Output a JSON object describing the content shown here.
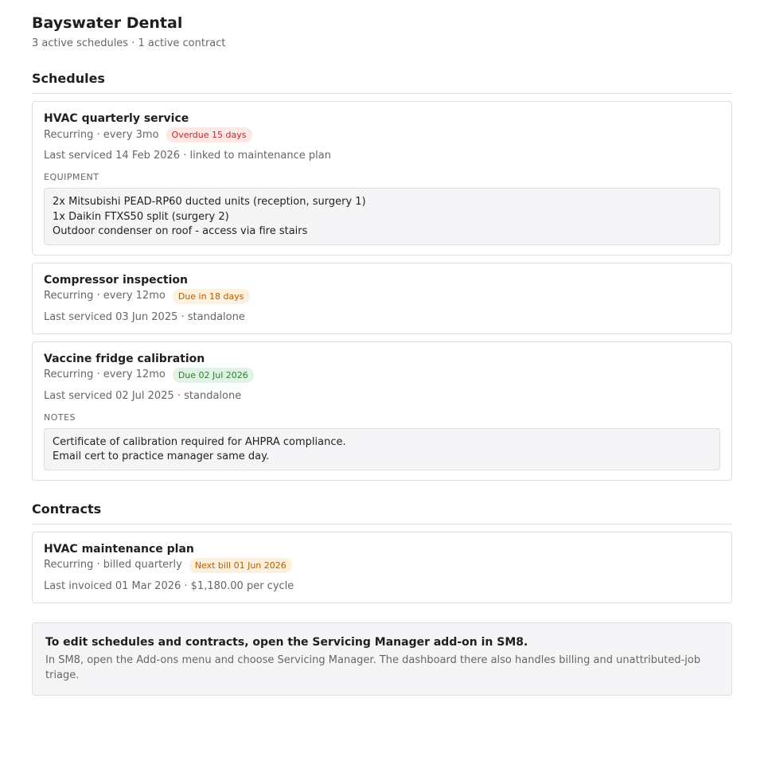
{
  "header": {
    "title": "Bayswater Dental",
    "subtitle": "3 active schedules · 1 active contract"
  },
  "schedules": {
    "heading": "Schedules",
    "items": [
      {
        "title": "HVAC quarterly service",
        "recurrence": "Recurring · every 3mo",
        "badge": "Overdue 15 days",
        "badge_color": "#c62828",
        "detail": "Last serviced 14 Feb 2026 · linked to maintenance plan",
        "extra_label": "EQUIPMENT",
        "extra_lines": [
          "2x Mitsubishi PEAD-RP60 ducted units (reception, surgery 1)",
          "1x Daikin FTXS50 split (surgery 2)",
          "Outdoor condenser on roof - access via fire stairs"
        ]
      },
      {
        "title": "Compressor inspection",
        "recurrence": "Recurring · every 12mo",
        "badge": "Due in 18 days",
        "badge_color": "#b35f00",
        "detail": "Last serviced 03 Jun 2025 · standalone"
      },
      {
        "title": "Vaccine fridge calibration",
        "recurrence": "Recurring · every 12mo",
        "badge": "Due 02 Jul 2026",
        "badge_color": "#2e7d32",
        "detail": "Last serviced 02 Jul 2025 · standalone",
        "extra_label": "NOTES",
        "extra_lines": [
          "Certificate of calibration required for AHPRA compliance.",
          "Email cert to practice manager same day."
        ]
      }
    ]
  },
  "contracts": {
    "heading": "Contracts",
    "items": [
      {
        "title": "HVAC maintenance plan",
        "recurrence": "Recurring · billed quarterly",
        "badge": "Next bill 01 Jun 2026",
        "badge_color": "#b35f00",
        "detail": "Last invoiced 01 Mar 2026 · $1,180.00 per cycle"
      }
    ]
  },
  "footer": {
    "title": "To edit schedules and contracts, open the Servicing Manager add-on in SM8.",
    "body": "In SM8, open the Add-ons menu and choose Servicing Manager. The dashboard there also handles billing and unattributed-job triage."
  }
}
